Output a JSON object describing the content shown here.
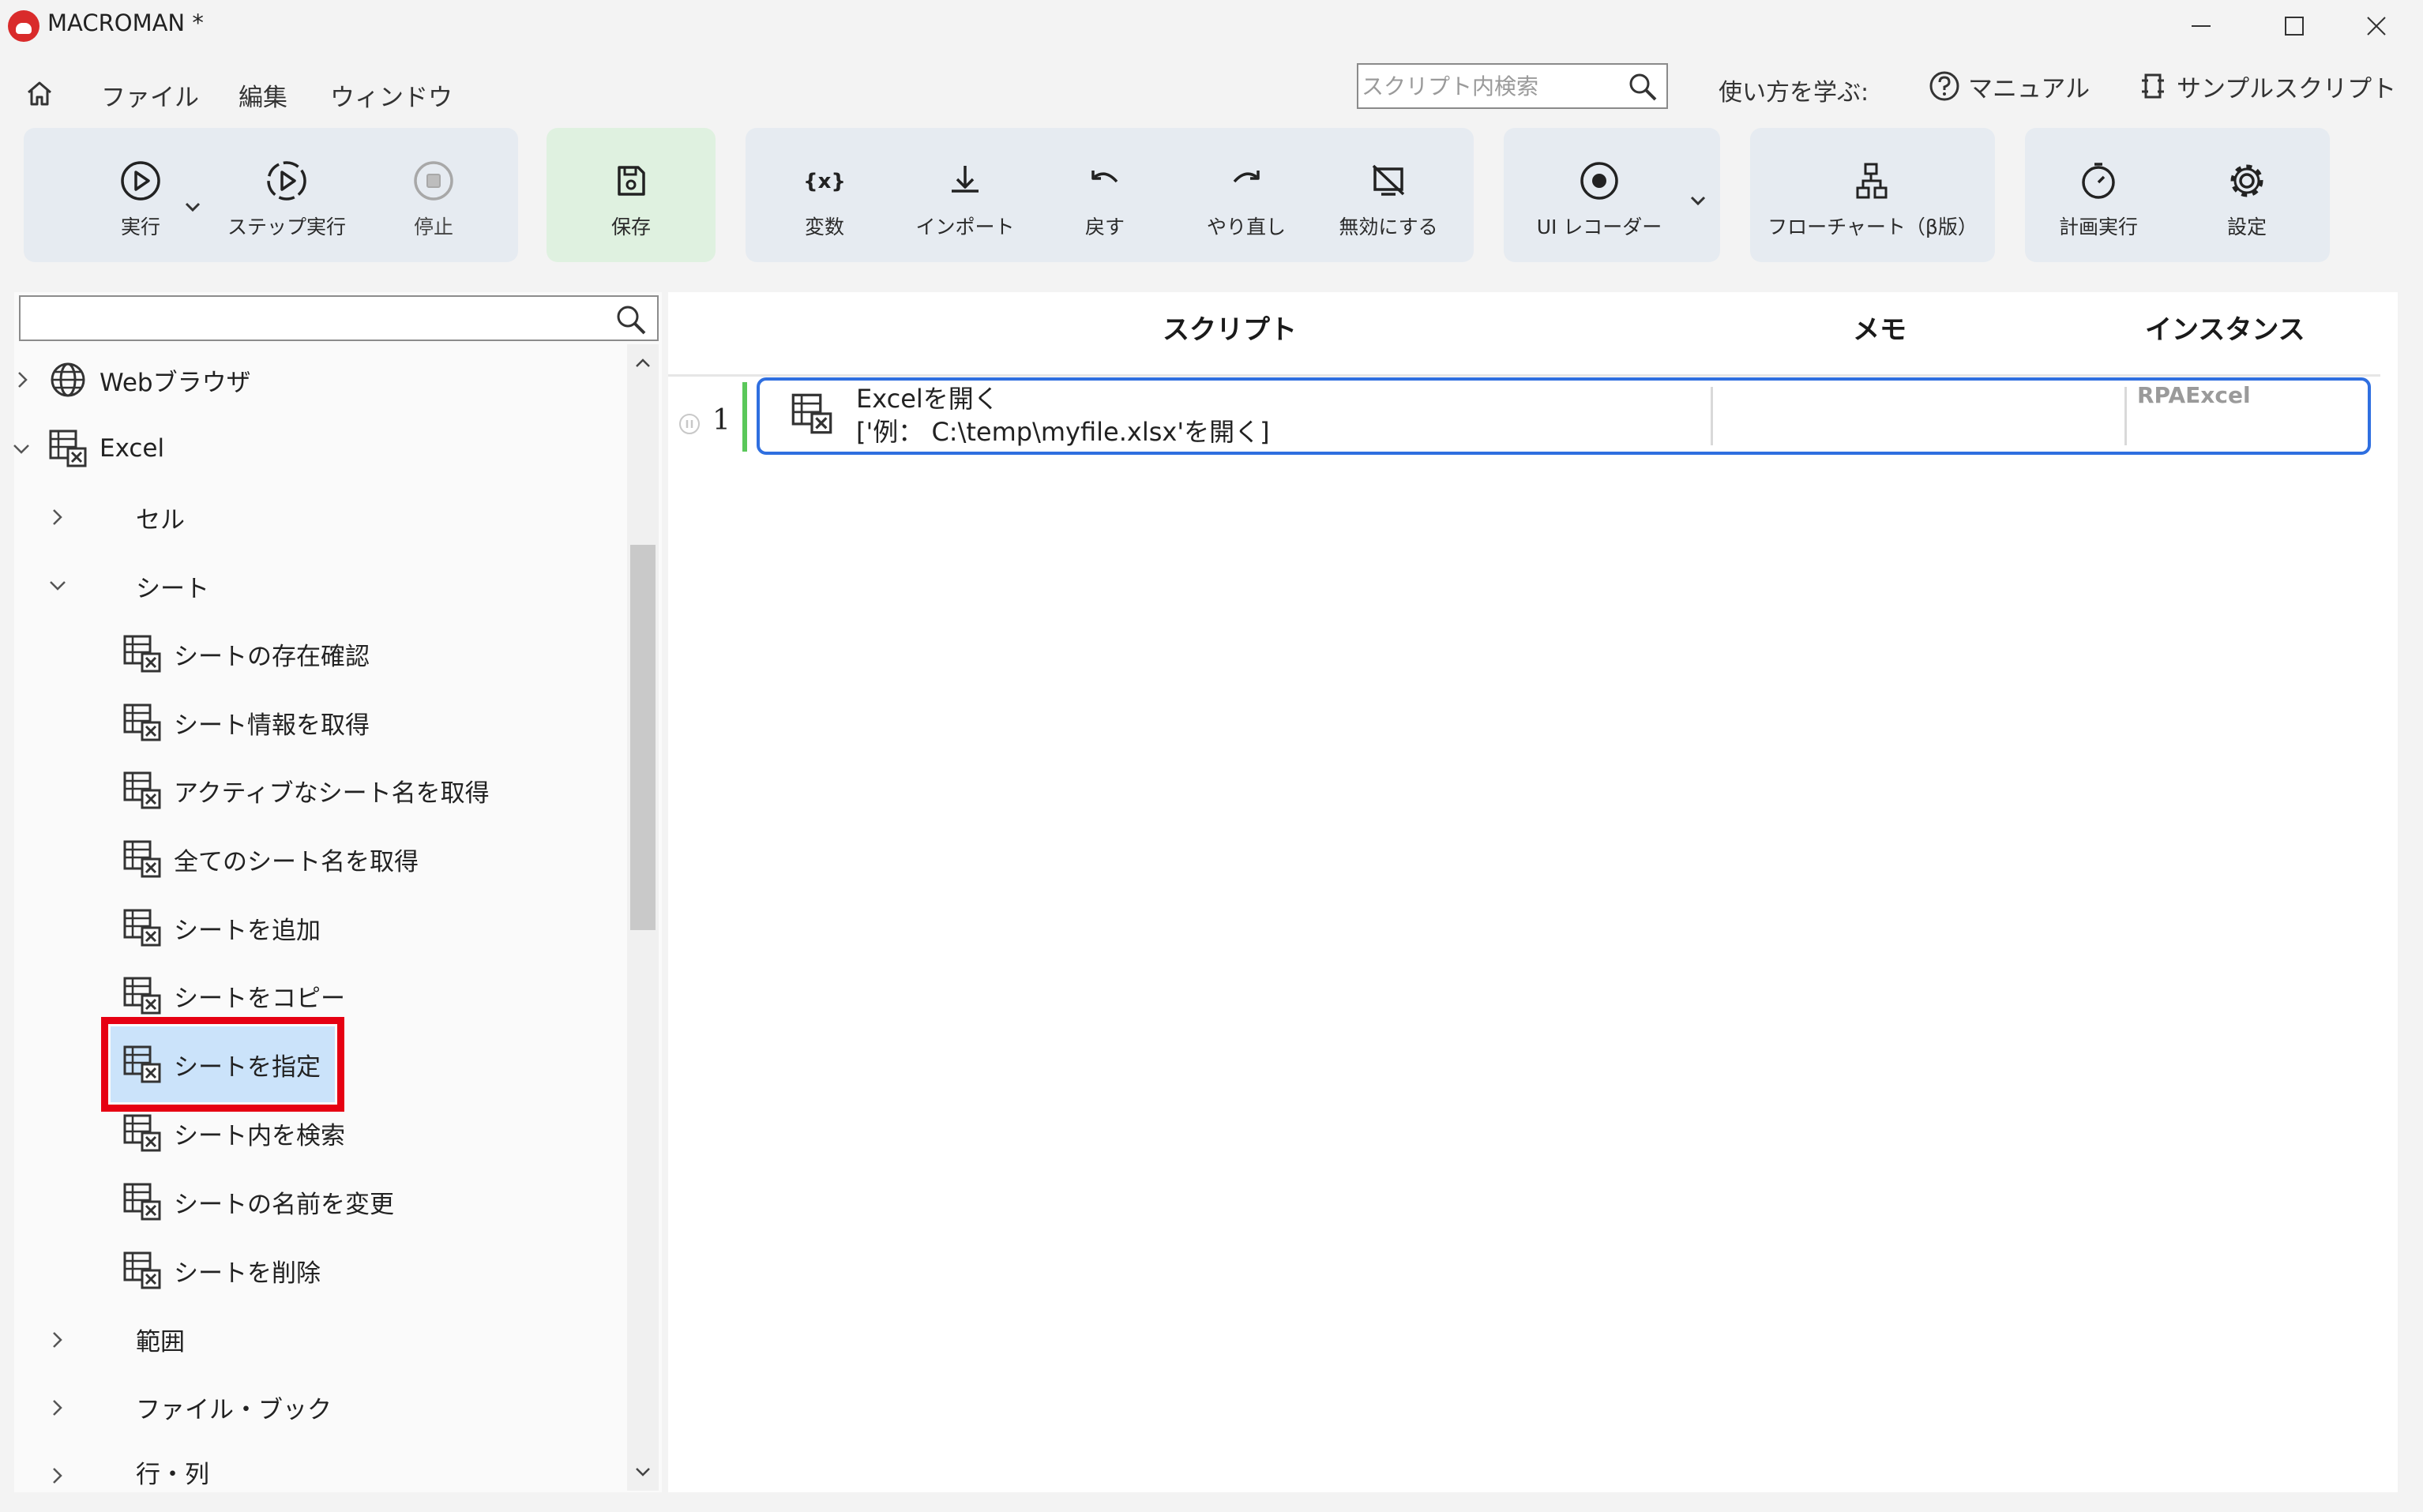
{
  "window": {
    "title": "MACROMAN *"
  },
  "menu": {
    "items": [
      "ファイル",
      "編集",
      "ウィンドウ"
    ]
  },
  "script_search": {
    "placeholder": "スクリプト内検索"
  },
  "help": {
    "learn_label": "使い方を学ぶ:",
    "manual_label": "マニュアル",
    "samples_label": "サンプルスクリプト"
  },
  "toolbar": {
    "run": "実行",
    "step_run": "ステップ実行",
    "stop": "停止",
    "save": "保存",
    "variables": "変数",
    "import": "インポート",
    "undo": "戻す",
    "redo": "やり直し",
    "disable": "無効にする",
    "ui_recorder": "UI レコーダー",
    "flowchart": "フローチャート（β版）",
    "scheduled_run": "計画実行",
    "settings": "設定"
  },
  "tree": {
    "filter_value": "",
    "web_browser": "Webブラウザ",
    "excel": "Excel",
    "cell": "セル",
    "sheet": "シート",
    "sheet_items": [
      "シートの存在確認",
      "シート情報を取得",
      "アクティブなシート名を取得",
      "全てのシート名を取得",
      "シートを追加",
      "シートをコピー",
      "シートを指定",
      "シート内を検索",
      "シートの名前を変更",
      "シートを削除"
    ],
    "selected_item": "シートを指定",
    "range": "範囲",
    "file_book": "ファイル・ブック",
    "row_col": "行・列"
  },
  "editor": {
    "columns": {
      "script": "スクリプト",
      "memo": "メモ",
      "instance": "インスタンス"
    },
    "rows": [
      {
        "number": "1",
        "title": "Excelを開く",
        "description": "['例： C:\\temp\\myfile.xlsx'を開く]",
        "memo": "",
        "instance": "RPAExcel"
      }
    ]
  },
  "colors": {
    "accent_blue": "#2f6fe0",
    "selection_highlight": "#e60012",
    "selected_fill": "#cbe3fa",
    "save_group_bg": "#dff1e0",
    "toolbar_group_bg": "#e6ebf1",
    "logo_red": "#d92b2b"
  }
}
